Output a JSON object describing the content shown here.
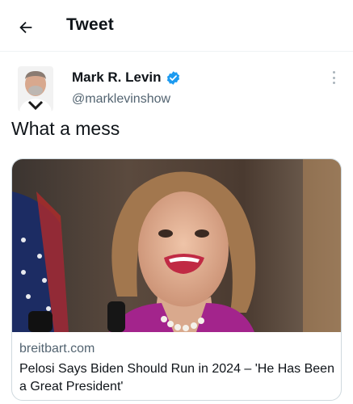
{
  "header": {
    "title": "Tweet",
    "back_icon": "arrow-left-icon"
  },
  "tweet": {
    "author": {
      "display_name": "Mark R. Levin",
      "handle": "@marklevinshow",
      "verified": true,
      "verified_color": "#1d9bf0"
    },
    "text": "What a mess",
    "more_icon": "more-vertical-icon"
  },
  "card": {
    "domain": "breitbart.com",
    "title": "Pelosi Says Biden Should Run in 2024 – 'He Has Been a Great President'"
  }
}
